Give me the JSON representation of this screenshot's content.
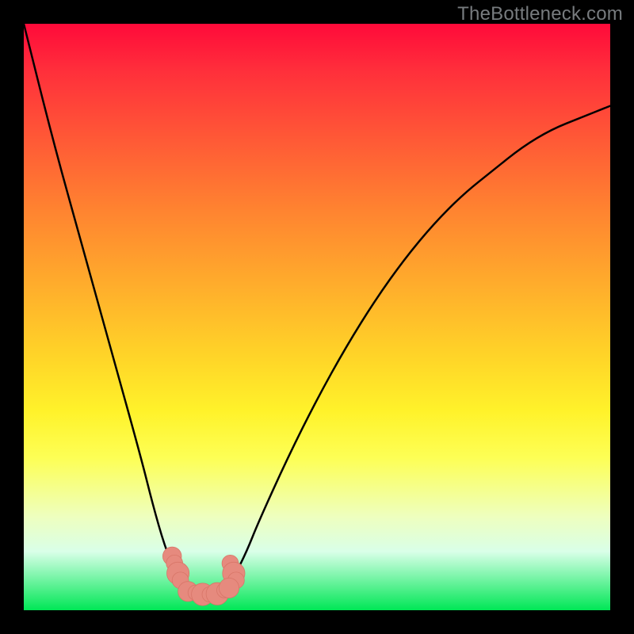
{
  "watermark": "TheBottleneck.com",
  "colors": {
    "background": "#000000",
    "gradient_top": "#ff0a3a",
    "gradient_bottom": "#00e756",
    "curve": "#000000",
    "marker_fill": "#e68a7e",
    "marker_stroke": "#d87668"
  },
  "chart_data": {
    "type": "line",
    "title": "",
    "xlabel": "",
    "ylabel": "",
    "xlim": [
      0,
      100
    ],
    "ylim": [
      0,
      100
    ],
    "grid": false,
    "description": "V-shaped bottleneck curve with minimum plateau near x≈28–34 and rising limbs on both sides",
    "series": [
      {
        "name": "curve",
        "x": [
          0,
          5,
          10,
          15,
          20,
          22,
          24,
          26,
          28,
          30,
          32,
          34,
          36,
          38,
          40,
          45,
          50,
          55,
          60,
          65,
          70,
          75,
          80,
          85,
          90,
          95,
          100
        ],
        "y": [
          100,
          80,
          62,
          44,
          26,
          18,
          11,
          6,
          3,
          2,
          2,
          3,
          6,
          10,
          15,
          26,
          36,
          45,
          53,
          60,
          66,
          71,
          75,
          79,
          82,
          84,
          86
        ]
      }
    ],
    "markers": [
      {
        "x": 25.3,
        "y": 9.2,
        "r": 1.6
      },
      {
        "x": 25.7,
        "y": 8.0,
        "r": 1.4
      },
      {
        "x": 26.3,
        "y": 6.3,
        "r": 1.9
      },
      {
        "x": 26.7,
        "y": 5.1,
        "r": 1.4
      },
      {
        "x": 35.2,
        "y": 8.0,
        "r": 1.4
      },
      {
        "x": 35.8,
        "y": 6.3,
        "r": 1.9
      },
      {
        "x": 36.2,
        "y": 5.1,
        "r": 1.4
      },
      {
        "x": 28.0,
        "y": 3.2,
        "r": 1.7
      },
      {
        "x": 29.3,
        "y": 3.0,
        "r": 1.3
      },
      {
        "x": 30.5,
        "y": 2.7,
        "r": 1.9
      },
      {
        "x": 31.7,
        "y": 2.7,
        "r": 1.3
      },
      {
        "x": 33.0,
        "y": 2.8,
        "r": 1.9
      },
      {
        "x": 34.2,
        "y": 3.4,
        "r": 1.3
      },
      {
        "x": 35.0,
        "y": 3.8,
        "r": 1.7
      }
    ]
  }
}
